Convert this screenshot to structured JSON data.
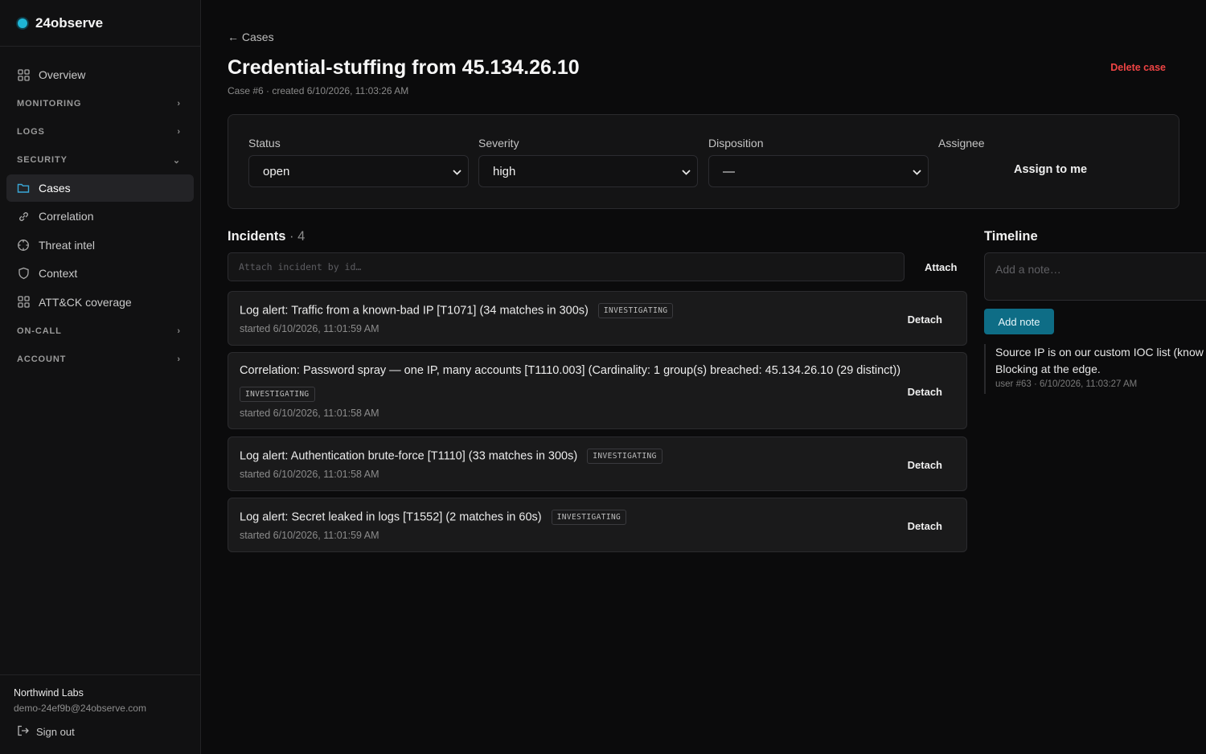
{
  "brand": {
    "name": "24observe"
  },
  "nav": {
    "overview": "Overview",
    "monitoring": "MONITORING",
    "logs": "LOGS",
    "security": "SECURITY",
    "cases": "Cases",
    "correlation": "Correlation",
    "threat_intel": "Threat intel",
    "context": "Context",
    "attck": "ATT&CK coverage",
    "oncall": "ON-CALL",
    "account": "ACCOUNT"
  },
  "footer": {
    "org": "Northwind Labs",
    "email": "demo-24ef9b@24observe.com",
    "signout": "Sign out"
  },
  "page": {
    "back": "← Cases",
    "title": "Credential-stuffing from 45.134.26.10",
    "meta": "Case #6 · created 6/10/2026, 11:03:26 AM",
    "delete": "Delete case"
  },
  "fields": {
    "status_label": "Status",
    "status_value": "open",
    "severity_label": "Severity",
    "severity_value": "high",
    "disposition_label": "Disposition",
    "disposition_value": "—",
    "assignee_label": "Assignee",
    "assign_button": "Assign to me"
  },
  "incidents": {
    "title": "Incidents",
    "count": "· 4",
    "placeholder": "Attach incident by id…",
    "attach": "Attach",
    "detach": "Detach",
    "items": [
      {
        "title": "Log alert: Traffic from a known-bad IP [T1071] (34 matches in 300s)",
        "status": "INVESTIGATING",
        "started": "started 6/10/2026, 11:01:59 AM"
      },
      {
        "title": "Correlation: Password spray — one IP, many accounts [T1110.003] (Cardinality: 1 group(s) breached: 45.134.26.10 (29 distinct))",
        "status": "INVESTIGATING",
        "started": "started 6/10/2026, 11:01:58 AM"
      },
      {
        "title": "Log alert: Authentication brute-force [T1110] (33 matches in 300s)",
        "status": "INVESTIGATING",
        "started": "started 6/10/2026, 11:01:58 AM"
      },
      {
        "title": "Log alert: Secret leaked in logs [T1552] (2 matches in 60s)",
        "status": "INVESTIGATING",
        "started": "started 6/10/2026, 11:01:59 AM"
      }
    ]
  },
  "timeline": {
    "title": "Timeline",
    "placeholder": "Add a note…",
    "add_note": "Add note",
    "entry_line1": "Source IP is on our custom IOC list (know",
    "entry_line2": "Blocking at the edge.",
    "entry_meta": "user #63 · 6/10/2026, 11:03:27 AM"
  }
}
